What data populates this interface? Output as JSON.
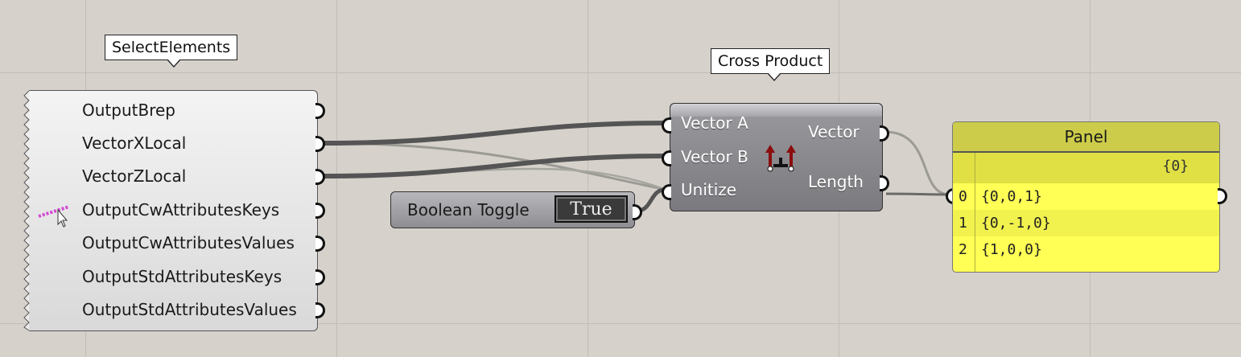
{
  "select_elements": {
    "name": "SelectElements",
    "outputs": [
      "OutputBrep",
      "VectorXLocal",
      "VectorZLocal",
      "OutputCwAttributesKeys",
      "OutputCwAttributesValues",
      "OutputStdAttributesKeys",
      "OutputStdAttributesValues"
    ]
  },
  "cross_product": {
    "name": "Cross Product",
    "inputs": [
      "Vector A",
      "Vector B",
      "Unitize"
    ],
    "outputs": [
      "Vector",
      "Length"
    ],
    "icon": "cross-product-icon"
  },
  "boolean_toggle": {
    "label": "Boolean Toggle",
    "value": "True"
  },
  "panel": {
    "title": "Panel",
    "branch": "{0}",
    "items": [
      {
        "index": "0",
        "value": "{0,0,1}"
      },
      {
        "index": "1",
        "value": "{0,-1,0}"
      },
      {
        "index": "2",
        "value": "{1,0,0}"
      }
    ]
  },
  "colors": {
    "canvas": "#d6d2cb",
    "panel": "#ffff55",
    "wire": "#555555"
  }
}
